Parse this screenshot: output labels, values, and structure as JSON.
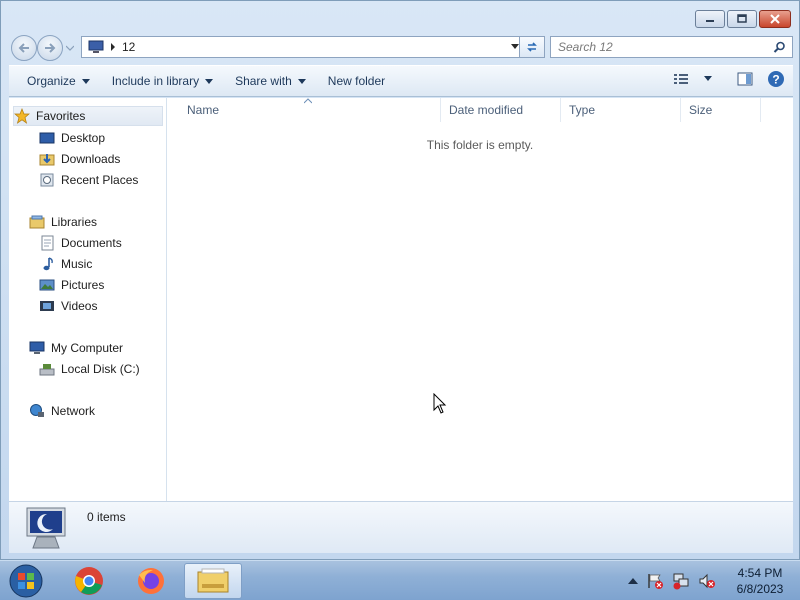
{
  "window": {
    "buttons": {
      "minimize": "minimize",
      "maximize": "maximize",
      "close": "close"
    }
  },
  "address": {
    "path": "12",
    "search_placeholder": "Search 12"
  },
  "commands": {
    "organize": "Organize",
    "include_in_library": "Include in library",
    "share_with": "Share with",
    "new_folder": "New folder"
  },
  "nav": {
    "favorites": "Favorites",
    "desktop": "Desktop",
    "downloads": "Downloads",
    "recent_places": "Recent Places",
    "libraries": "Libraries",
    "documents": "Documents",
    "music": "Music",
    "pictures": "Pictures",
    "videos": "Videos",
    "my_computer": "My Computer",
    "local_disk": "Local Disk (C:)",
    "network": "Network"
  },
  "columns": {
    "name": "Name",
    "date_modified": "Date modified",
    "type": "Type",
    "size": "Size"
  },
  "content": {
    "empty_message": "This folder is empty."
  },
  "details": {
    "items_count": "0 items"
  },
  "taskbar": {
    "apps": [
      "start-orb",
      "chrome",
      "firefox",
      "windows-explorer"
    ],
    "time": "4:54 PM",
    "date": "6/8/2023"
  },
  "colors": {
    "accent": "#1e395b",
    "selection": "#e1e9f3",
    "close": "#c8452c"
  }
}
